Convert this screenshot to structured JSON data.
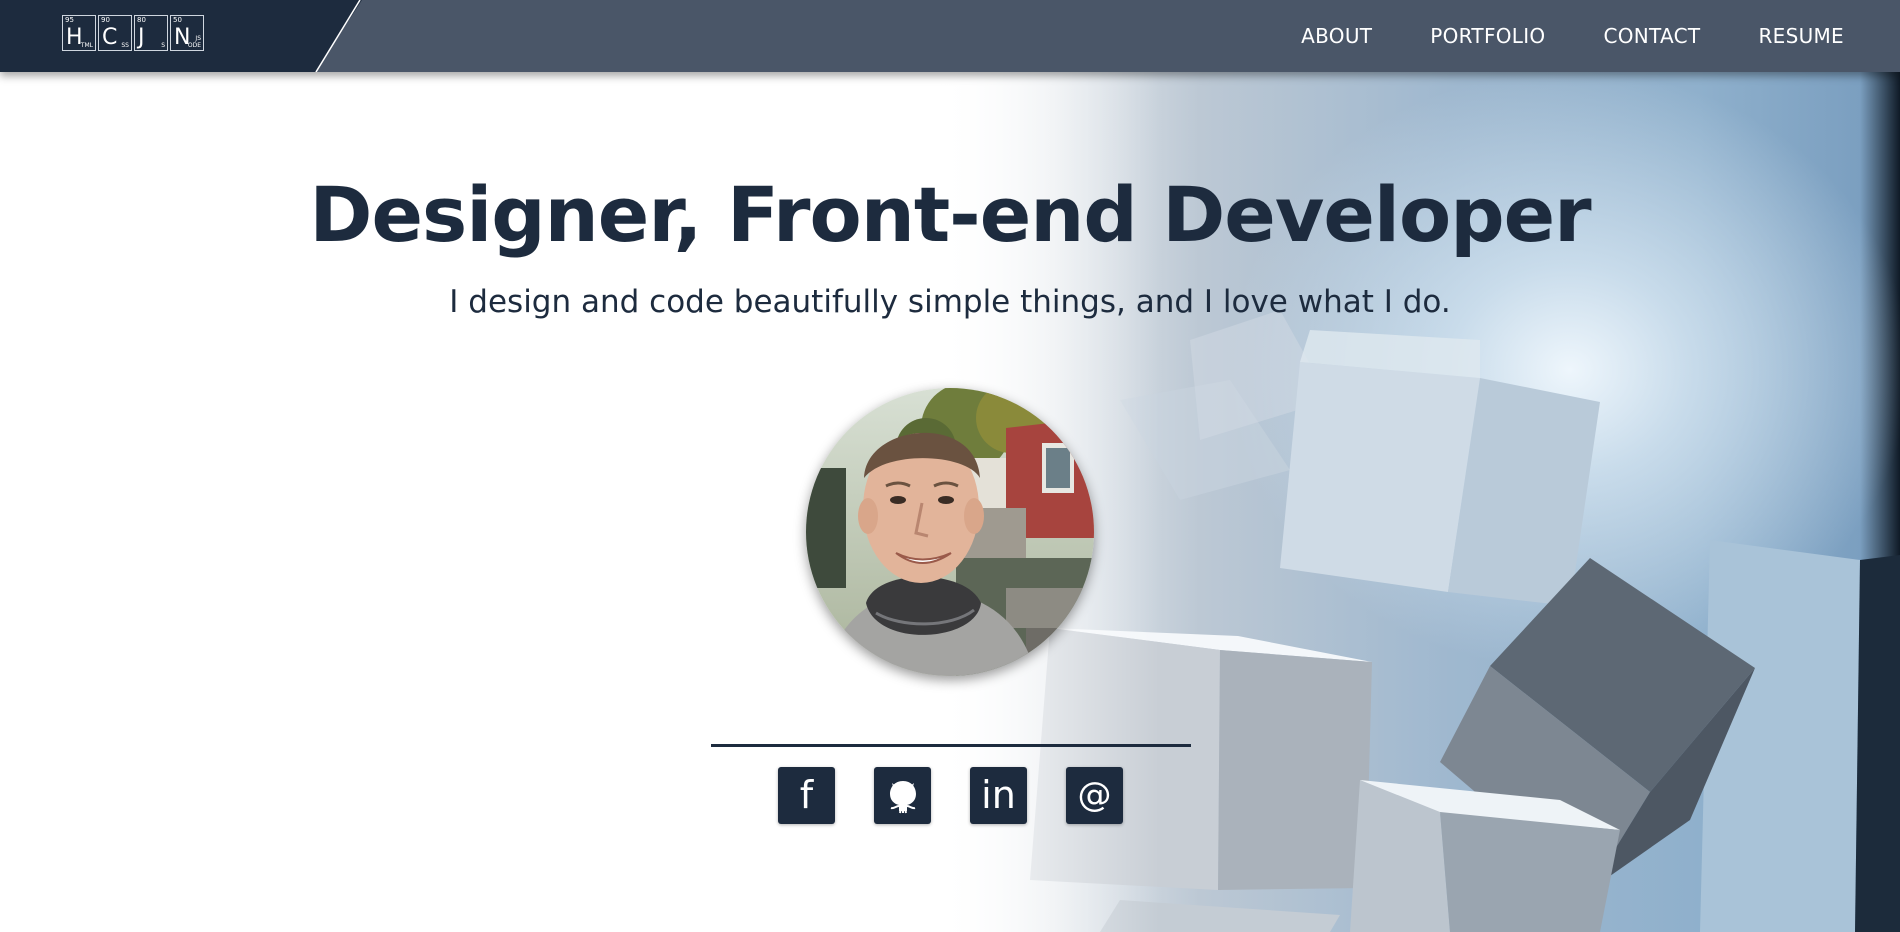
{
  "header": {
    "logo": {
      "tiles": [
        {
          "number": "95",
          "symbol": "H",
          "sub": "TML"
        },
        {
          "number": "90",
          "symbol": "C",
          "sub": "SS"
        },
        {
          "number": "80",
          "symbol": "J",
          "sub": "S"
        },
        {
          "number": "50",
          "symbol": "N",
          "sub": "JS\nODE"
        }
      ]
    },
    "nav": [
      {
        "label": "ABOUT"
      },
      {
        "label": "PORTFOLIO"
      },
      {
        "label": "CONTACT"
      },
      {
        "label": "RESUME"
      }
    ]
  },
  "hero": {
    "title": "Designer, Front-end Developer",
    "subtitle": "I design and code beautifully simple things, and I love what I do."
  },
  "socials": [
    {
      "label": "f",
      "icon": "facebook-icon"
    },
    {
      "label": "",
      "icon": "github-icon"
    },
    {
      "label": "in",
      "icon": "linkedin-icon"
    },
    {
      "label": "@",
      "icon": "email-icon"
    }
  ],
  "colors": {
    "navy": "#1d2b3e",
    "header": "#4a5668",
    "white": "#ffffff"
  }
}
